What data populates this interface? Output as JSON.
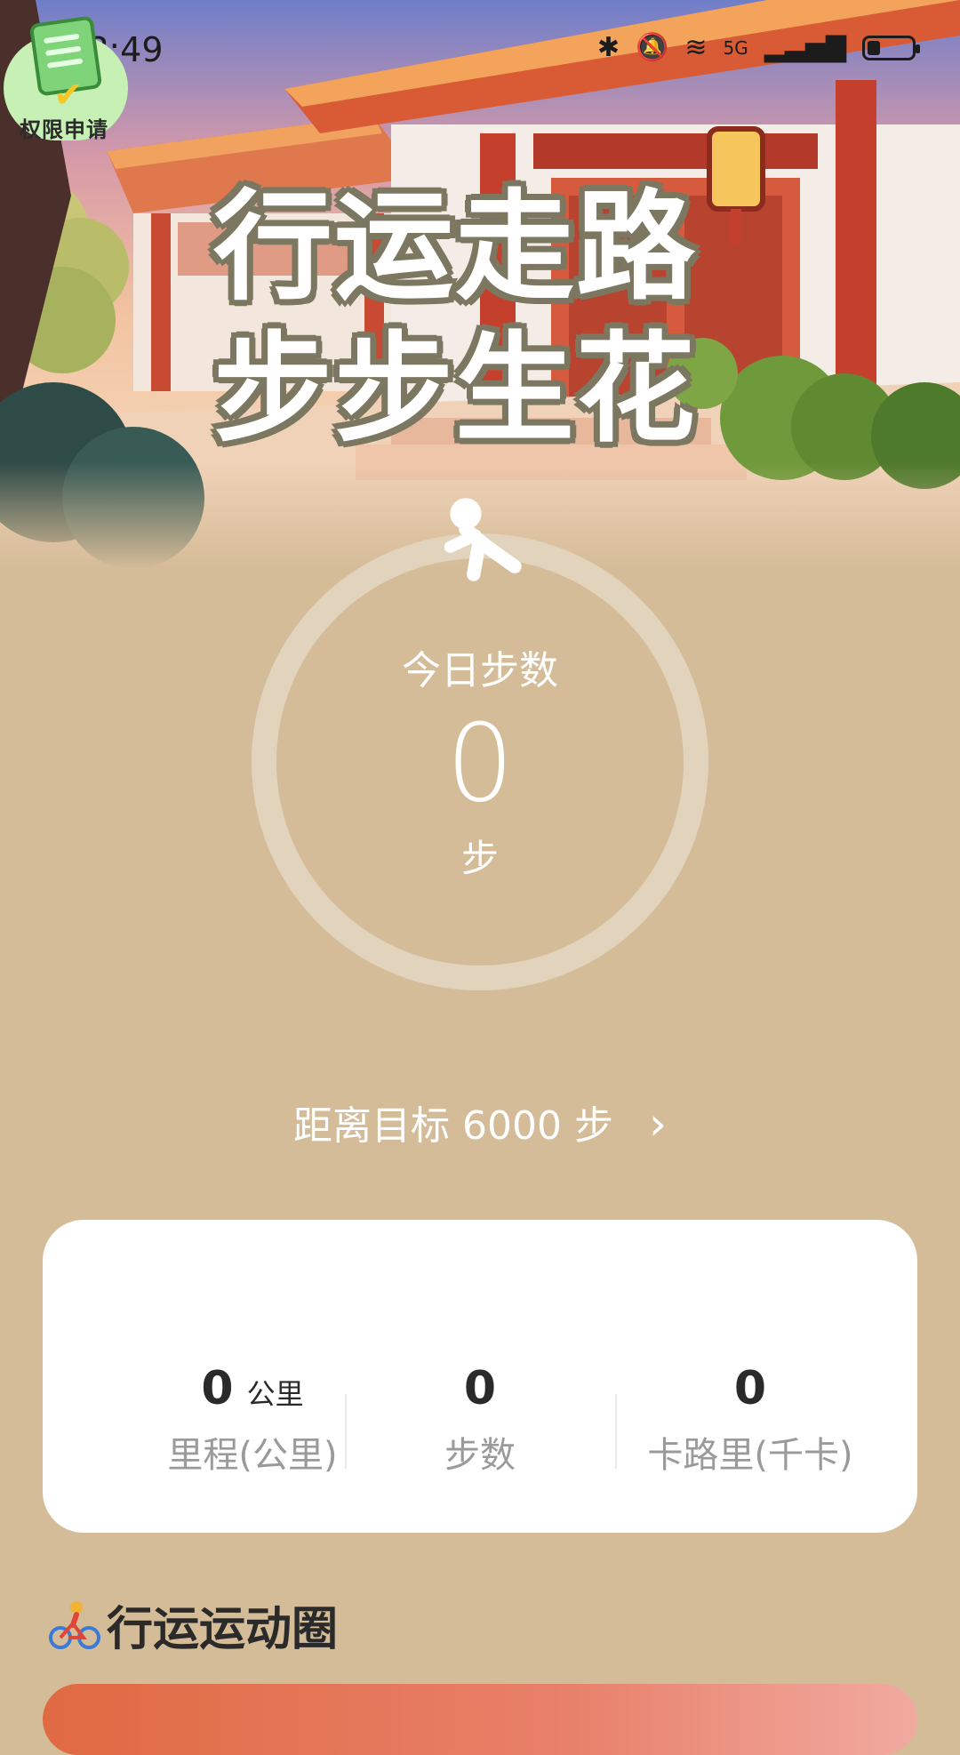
{
  "status_bar": {
    "time": "18:49",
    "network": "5G",
    "icons": [
      "bluetooth-icon",
      "mute-icon",
      "wifi-icon",
      "signal-icon",
      "battery-icon"
    ]
  },
  "permission_badge": {
    "label": "权限申请",
    "icon": "clipboard-check-icon"
  },
  "hero": {
    "slogan_line1": "行运走路",
    "slogan_line2": "步步生花"
  },
  "steps_ring": {
    "title": "今日步数",
    "value": "0",
    "unit": "步",
    "progress": 0
  },
  "goal": {
    "text": "距离目标 6000 步",
    "chevron": "chevron-right-icon"
  },
  "stats": [
    {
      "value": "0",
      "unit": "公里",
      "label": "里程(公里)"
    },
    {
      "value": "0",
      "unit": "",
      "label": "步数"
    },
    {
      "value": "0",
      "unit": "",
      "label": "卡路里(千卡)"
    }
  ],
  "section": {
    "title": "行运运动圈",
    "icon": "cyclist-icon"
  },
  "colors": {
    "page_bg": "#d5bc98",
    "ring": "#e2d3bd",
    "card_bg": "#ffffff",
    "accent": "#e06a42"
  }
}
